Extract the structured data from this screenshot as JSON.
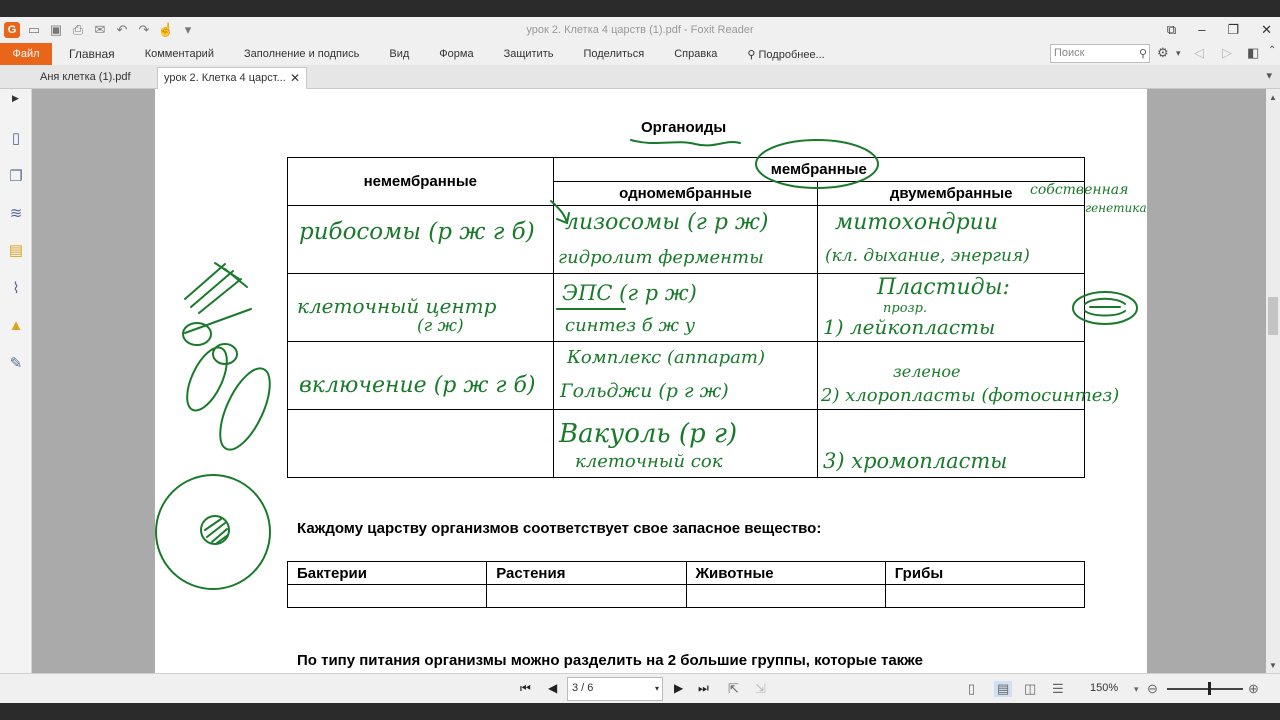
{
  "window": {
    "title": "урок 2. Клетка 4 царств (1).pdf - Foxit Reader"
  },
  "ribbon": {
    "file_tab": "Файл",
    "menu": [
      "Главная",
      "Комментарий",
      "Заполнение и подпись",
      "Вид",
      "Форма",
      "Защитить",
      "Поделиться",
      "Справка",
      "Подробнее..."
    ],
    "search_placeholder": "Поиск"
  },
  "tabs": [
    {
      "label": "Аня клетка (1).pdf",
      "active": false
    },
    {
      "label": "урок 2. Клетка 4 царст...",
      "active": true
    }
  ],
  "document": {
    "title": "Органоиды",
    "table_headers": {
      "nonmembrane": "немембранные",
      "membrane": "мембранные",
      "single": "одномембранные",
      "double": "двумембранные"
    },
    "sentence1": "Каждому царству организмов  соответствует свое запасное вещество:",
    "kingdom_headers": [
      "Бактерии",
      "Растения",
      "Животные",
      "Грибы"
    ],
    "sentence2": "По типу питания организмы можно разделить на 2 большие группы, которые также"
  },
  "handwriting": {
    "r1c1": "рибосомы (р ж г б)",
    "r1c2a": "лизосомы (г р ж)",
    "r1c2b": "гидролит ферменты",
    "r1c3a": "митохондрии",
    "r1c3b": "(кл. дыхание, энергия)",
    "side_note_a": "собственная",
    "side_note_b": "генетика",
    "r2c1a": "клеточный центр",
    "r2c1b": "(г ж)",
    "r2c2a": "ЭПС (г р ж)",
    "r2c2b": "синтез б ж у",
    "r2c3a": "Пластиды:",
    "r2c3b": "прозр.",
    "r2c3c": "1) лейкопласты",
    "r3c1": "включение (р ж г б)",
    "r3c2a": "Комплекс (аппарат)",
    "r3c2b": "Гольджи (р г ж)",
    "r3c3a": "зеленое",
    "r3c3b": "2) хлоропласты (фотосинтез)",
    "r4c2a": "Вакуоль (р г)",
    "r4c2b": "клеточный сок",
    "r4c3": "3) хромопласты"
  },
  "statusbar": {
    "page": "3 / 6",
    "zoom": "150%"
  },
  "colors": {
    "ink": "#1a7a2b",
    "accent": "#e8651a"
  }
}
